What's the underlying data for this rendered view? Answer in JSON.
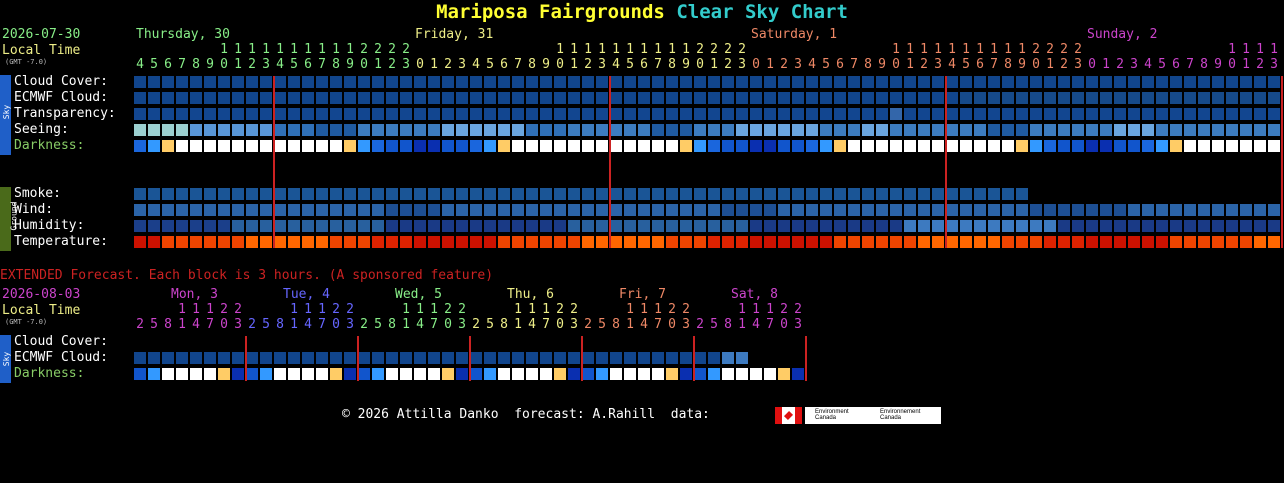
{
  "header": {
    "site": "Mariposa Fairgrounds",
    "chart_name": "Clear Sky Chart",
    "date": "2026-07-30",
    "local_time_label": "Local Time",
    "gmt_offset": "(GMT -7.0)"
  },
  "days": [
    {
      "label": "Thursday, 30",
      "color": "#88ee88"
    },
    {
      "label": "Friday, 31",
      "color": "#eeee88"
    },
    {
      "label": "Saturday, 1",
      "color": "#ee8866"
    },
    {
      "label": "Sunday, 2",
      "color": "#cc44cc"
    }
  ],
  "hours": {
    "start": 4,
    "count": 44,
    "colors": [
      "#88ee88",
      "#eeee88",
      "#ee8866",
      "#cc44cc"
    ],
    "day_starts": [
      0,
      20,
      44,
      68,
      92
    ]
  },
  "side_tabs": {
    "sky": "Sky",
    "ground": "Ground"
  },
  "rows": {
    "sky": [
      {
        "label": "Cloud Cover:"
      },
      {
        "label": "ECMWF Cloud:"
      },
      {
        "label": "Transparency:"
      },
      {
        "label": "Seeing:"
      },
      {
        "label": "Darkness:",
        "color": "#88cc66"
      }
    ],
    "ground": [
      {
        "label": "Smoke:"
      },
      {
        "label": "Wind:"
      },
      {
        "label": "Humidity:"
      },
      {
        "label": "Temperature:"
      }
    ]
  },
  "extended": {
    "banner": "EXTENDED Forecast. Each block is 3 hours. (A sponsored feature)",
    "date": "2026-08-03",
    "local_time_label": "Local Time",
    "gmt_offset": "(GMT -7.0)",
    "days": [
      {
        "label": "Mon, 3",
        "color": "#cc44cc"
      },
      {
        "label": "Tue, 4",
        "color": "#6666ff"
      },
      {
        "label": "Wed, 5",
        "color": "#88ee88"
      },
      {
        "label": "Thu, 6",
        "color": "#eeee88"
      },
      {
        "label": "Fri, 7",
        "color": "#ee8866"
      },
      {
        "label": "Sat, 8",
        "color": "#cc44cc"
      }
    ],
    "hours_pattern": [
      "2",
      "5",
      "8",
      "11",
      "14",
      "17",
      "20",
      "23"
    ],
    "rows": [
      {
        "label": "Cloud Cover:"
      },
      {
        "label": "ECMWF Cloud:"
      },
      {
        "label": "Darkness:",
        "color": "#88cc66"
      }
    ]
  },
  "footer": {
    "copyright": "© 2026 Attilla Danko",
    "forecast": "forecast: A.Rahill",
    "data": "data:",
    "logo_text_1": "Environment Canada",
    "logo_text_2": "Environnement Canada"
  },
  "colors": {
    "sky_blue": "#1c4c8c",
    "grid_line": "#cc2222",
    "title": "#ffff33",
    "chart_name": "#33cccc",
    "banner": "#cc2222"
  }
}
